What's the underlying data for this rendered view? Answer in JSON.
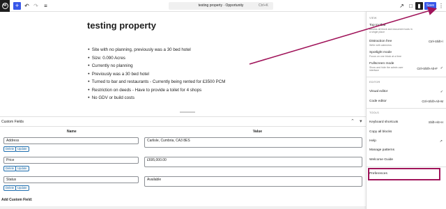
{
  "topbar": {
    "command_title": "testing property · Opportunity",
    "command_shortcut": "Ctrl+K",
    "save_label": "Save"
  },
  "post": {
    "title": "testing property",
    "bullets": [
      "Site with no planning, previously was a 30 bed hotel",
      "Size: 0.090 Acres",
      "Currently no planning",
      "Previously was a 30 bed hotel",
      "Turned to bar and restaurants - Currently being rented for £3500 PCM",
      "Restriction on deeds - Have to provide a toilet for 4 shops",
      "No GDV or build costs"
    ]
  },
  "custom_fields": {
    "title": "Custom Fields",
    "col_name": "Name",
    "col_value": "Value",
    "delete_label": "Delete",
    "update_label": "Update",
    "rows": [
      {
        "name": "Address",
        "value": "Carlisle, Cumbria, CA3 8ES"
      },
      {
        "name": "Price",
        "value": "£695,000.00"
      },
      {
        "name": "Status",
        "value": "Available"
      }
    ],
    "add_label": "Add Custom Field:"
  },
  "menu": {
    "view_label": "VIEW",
    "top_toolbar": {
      "label": "Top toolbar",
      "desc": "Access all block and document tools in a single place"
    },
    "distraction_free": {
      "label": "Distraction free",
      "desc": "Write with calmness",
      "shortcut": "Ctrl+Shift+\\"
    },
    "spotlight": {
      "label": "Spotlight mode",
      "desc": "Focus on one block at a time"
    },
    "fullscreen": {
      "label": "Fullscreen mode",
      "desc": "Show and hide the admin user interface",
      "shortcut": "Ctrl+Shift+Alt+F"
    },
    "editor_label": "EDITOR",
    "visual_editor": {
      "label": "Visual editor"
    },
    "code_editor": {
      "label": "Code editor",
      "shortcut": "Ctrl+Shift+Alt+M"
    },
    "tools_label": "TOOLS",
    "keyboard_shortcuts": {
      "label": "Keyboard shortcuts",
      "shortcut": "Shift+Alt+H"
    },
    "copy_all_blocks": {
      "label": "Copy all blocks"
    },
    "help": {
      "label": "Help"
    },
    "manage_patterns": {
      "label": "Manage patterns"
    },
    "welcome_guide": {
      "label": "Welcome Guide"
    },
    "preferences": {
      "label": "Preferences"
    }
  },
  "colors": {
    "accent": "#3858e9",
    "highlight": "#a0145a"
  }
}
